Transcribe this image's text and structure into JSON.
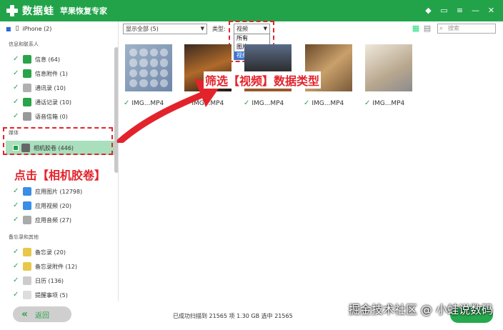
{
  "app": {
    "brand": "数据蛙",
    "product": "苹果恢复专家"
  },
  "sidebar": {
    "device": "iPhone (2)",
    "section_contacts": "信息和联系人",
    "items_contacts": [
      {
        "label": "信息 (64)",
        "icon": "message-icon",
        "color": "#2aa34a"
      },
      {
        "label": "信息附件 (1)",
        "icon": "message-attachment-icon",
        "color": "#2aa34a"
      },
      {
        "label": "通讯录 (10)",
        "icon": "contacts-icon",
        "color": "#b0b0b0"
      },
      {
        "label": "通话记录 (10)",
        "icon": "phone-icon",
        "color": "#2aa34a"
      },
      {
        "label": "语音信箱 (0)",
        "icon": "voicemail-icon",
        "color": "#999"
      }
    ],
    "section_media": "媒体",
    "camera_roll": "相机胶卷 (446)",
    "items_media": [
      {
        "label": "应用图片 (12798)",
        "icon": "app-photo-icon",
        "color": "#3a8ee6"
      },
      {
        "label": "应用视频 (20)",
        "icon": "app-video-icon",
        "color": "#3a8ee6"
      },
      {
        "label": "应用音频 (27)",
        "icon": "app-audio-icon",
        "color": "#aaa"
      }
    ],
    "section_memo": "备忘录和其他",
    "items_memo": [
      {
        "label": "备忘录 (20)",
        "icon": "notes-icon",
        "color": "#e8c84a"
      },
      {
        "label": "备忘录附件 (12)",
        "icon": "notes-attachment-icon",
        "color": "#e8c84a"
      },
      {
        "label": "日历 (136)",
        "icon": "calendar-icon",
        "color": "#ccc"
      },
      {
        "label": "提醒事项 (5)",
        "icon": "reminder-icon",
        "color": "#ddd"
      }
    ]
  },
  "toolbar": {
    "show_filter": "显示全部 (5)",
    "type_label": "类型:",
    "type_value": "视频",
    "type_options": [
      "所有",
      "图片",
      "视频"
    ],
    "search_placeholder": "搜索"
  },
  "files": [
    "IMG...MP4",
    "IMG...MP4",
    "IMG...MP4",
    "IMG...MP4",
    "IMG...MP4"
  ],
  "annotations": {
    "click_camera": "点击【相机胶卷】",
    "filter_video": "筛选【视频】数据类型"
  },
  "footer": {
    "back": "返回",
    "status": "已成功扫描到 21565 项 1.30 GB  选中 21565",
    "watermark": "掘金技术社区 @ 小蛙说数码"
  },
  "colors": {
    "accent": "#22a34a",
    "annotation": "#e3232c"
  }
}
